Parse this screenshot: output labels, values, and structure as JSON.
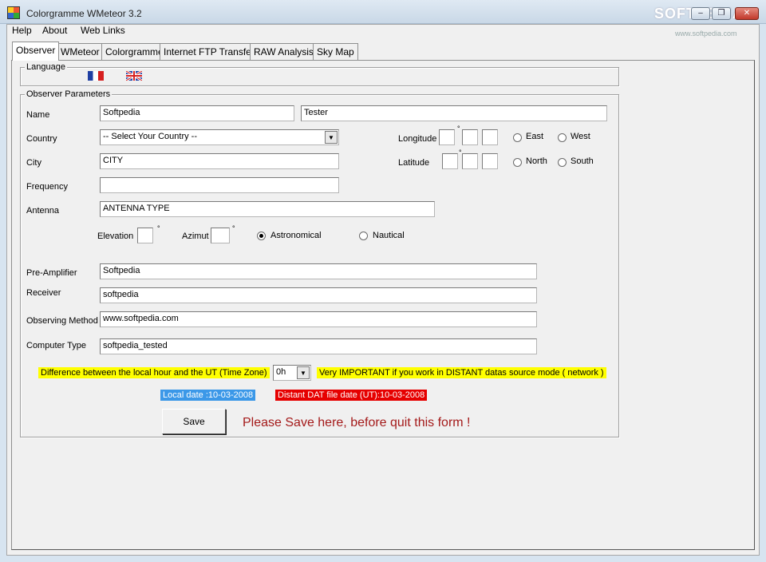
{
  "window": {
    "title": "Colorgramme WMeteor 3.2",
    "watermark": "SOFTPEDIA",
    "watermark_url": "www.softpedia.com",
    "minimize_glyph": "–",
    "maximize_glyph": "❐",
    "close_glyph": "✕"
  },
  "menu": {
    "items": [
      {
        "label": "Help"
      },
      {
        "label": "About"
      },
      {
        "label": "Web Links"
      }
    ]
  },
  "tabs": [
    {
      "label": "Observer",
      "active": true
    },
    {
      "label": "WMeteor",
      "active": false
    },
    {
      "label": "Colorgramme",
      "active": false
    },
    {
      "label": "Internet FTP Transfer",
      "active": false
    },
    {
      "label": "RAW Analysis",
      "active": false
    },
    {
      "label": "Sky Map",
      "active": false
    }
  ],
  "language": {
    "title": "Language",
    "flags": [
      "french-flag-icon",
      "uk-flag-icon"
    ]
  },
  "observer": {
    "title": "Observer Parameters",
    "name_label": "Name",
    "name_first": "Softpedia",
    "name_last": "Tester",
    "country_label": "Country",
    "country_value": "-- Select Your Country --",
    "city_label": "City",
    "city_value": "CITY",
    "frequency_label": "Frequency",
    "frequency_value": "",
    "antenna_label": "Antenna",
    "antenna_value": "ANTENNA TYPE",
    "longitude_label": "Longitude",
    "latitude_label": "Latitude",
    "east_label": "East",
    "west_label": "West",
    "north_label": "North",
    "south_label": "South",
    "degree_symbol": "°",
    "elevation_label": "Elevation",
    "azimut_label": "Azimut",
    "astronomical_label": "Astronomical",
    "nautical_label": "Nautical",
    "preamp_label": "Pre-Amplifier",
    "preamp_value": "Softpedia",
    "receiver_label": "Receiver",
    "receiver_value": "softpedia",
    "method_label": "Observing Method",
    "method_value": "www.softpedia.com",
    "computer_label": "Computer Type",
    "computer_value": "softpedia_tested",
    "timezone_text": "Difference between the local hour and the UT   (Time Zone)",
    "timezone_value": "0h",
    "important_text": "Very IMPORTANT if you work in DISTANT datas source mode ( network )",
    "local_date": "Local date :10-03-2008",
    "distant_date": "Distant DAT file date (UT):10-03-2008",
    "save_label": "Save",
    "save_hint": "Please Save here, before quit this form !"
  },
  "colors": {
    "highlight_yellow": "#ffff00",
    "highlight_blue": "#3b98e8",
    "highlight_red": "#e60000",
    "hint_text": "#a41a1a"
  }
}
